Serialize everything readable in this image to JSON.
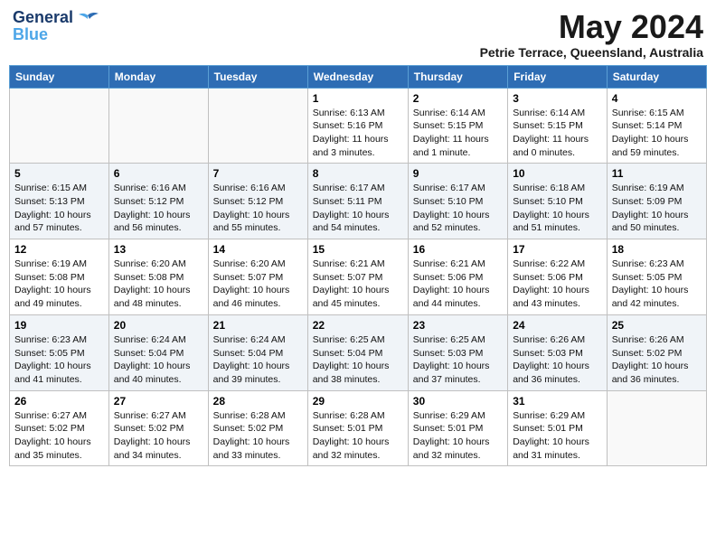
{
  "header": {
    "logo_line1": "General",
    "logo_line2": "Blue",
    "month_title": "May 2024",
    "location": "Petrie Terrace, Queensland, Australia"
  },
  "weekdays": [
    "Sunday",
    "Monday",
    "Tuesday",
    "Wednesday",
    "Thursday",
    "Friday",
    "Saturday"
  ],
  "weeks": [
    [
      {
        "day": "",
        "info": ""
      },
      {
        "day": "",
        "info": ""
      },
      {
        "day": "",
        "info": ""
      },
      {
        "day": "1",
        "info": "Sunrise: 6:13 AM\nSunset: 5:16 PM\nDaylight: 11 hours\nand 3 minutes."
      },
      {
        "day": "2",
        "info": "Sunrise: 6:14 AM\nSunset: 5:15 PM\nDaylight: 11 hours\nand 1 minute."
      },
      {
        "day": "3",
        "info": "Sunrise: 6:14 AM\nSunset: 5:15 PM\nDaylight: 11 hours\nand 0 minutes."
      },
      {
        "day": "4",
        "info": "Sunrise: 6:15 AM\nSunset: 5:14 PM\nDaylight: 10 hours\nand 59 minutes."
      }
    ],
    [
      {
        "day": "5",
        "info": "Sunrise: 6:15 AM\nSunset: 5:13 PM\nDaylight: 10 hours\nand 57 minutes."
      },
      {
        "day": "6",
        "info": "Sunrise: 6:16 AM\nSunset: 5:12 PM\nDaylight: 10 hours\nand 56 minutes."
      },
      {
        "day": "7",
        "info": "Sunrise: 6:16 AM\nSunset: 5:12 PM\nDaylight: 10 hours\nand 55 minutes."
      },
      {
        "day": "8",
        "info": "Sunrise: 6:17 AM\nSunset: 5:11 PM\nDaylight: 10 hours\nand 54 minutes."
      },
      {
        "day": "9",
        "info": "Sunrise: 6:17 AM\nSunset: 5:10 PM\nDaylight: 10 hours\nand 52 minutes."
      },
      {
        "day": "10",
        "info": "Sunrise: 6:18 AM\nSunset: 5:10 PM\nDaylight: 10 hours\nand 51 minutes."
      },
      {
        "day": "11",
        "info": "Sunrise: 6:19 AM\nSunset: 5:09 PM\nDaylight: 10 hours\nand 50 minutes."
      }
    ],
    [
      {
        "day": "12",
        "info": "Sunrise: 6:19 AM\nSunset: 5:08 PM\nDaylight: 10 hours\nand 49 minutes."
      },
      {
        "day": "13",
        "info": "Sunrise: 6:20 AM\nSunset: 5:08 PM\nDaylight: 10 hours\nand 48 minutes."
      },
      {
        "day": "14",
        "info": "Sunrise: 6:20 AM\nSunset: 5:07 PM\nDaylight: 10 hours\nand 46 minutes."
      },
      {
        "day": "15",
        "info": "Sunrise: 6:21 AM\nSunset: 5:07 PM\nDaylight: 10 hours\nand 45 minutes."
      },
      {
        "day": "16",
        "info": "Sunrise: 6:21 AM\nSunset: 5:06 PM\nDaylight: 10 hours\nand 44 minutes."
      },
      {
        "day": "17",
        "info": "Sunrise: 6:22 AM\nSunset: 5:06 PM\nDaylight: 10 hours\nand 43 minutes."
      },
      {
        "day": "18",
        "info": "Sunrise: 6:23 AM\nSunset: 5:05 PM\nDaylight: 10 hours\nand 42 minutes."
      }
    ],
    [
      {
        "day": "19",
        "info": "Sunrise: 6:23 AM\nSunset: 5:05 PM\nDaylight: 10 hours\nand 41 minutes."
      },
      {
        "day": "20",
        "info": "Sunrise: 6:24 AM\nSunset: 5:04 PM\nDaylight: 10 hours\nand 40 minutes."
      },
      {
        "day": "21",
        "info": "Sunrise: 6:24 AM\nSunset: 5:04 PM\nDaylight: 10 hours\nand 39 minutes."
      },
      {
        "day": "22",
        "info": "Sunrise: 6:25 AM\nSunset: 5:04 PM\nDaylight: 10 hours\nand 38 minutes."
      },
      {
        "day": "23",
        "info": "Sunrise: 6:25 AM\nSunset: 5:03 PM\nDaylight: 10 hours\nand 37 minutes."
      },
      {
        "day": "24",
        "info": "Sunrise: 6:26 AM\nSunset: 5:03 PM\nDaylight: 10 hours\nand 36 minutes."
      },
      {
        "day": "25",
        "info": "Sunrise: 6:26 AM\nSunset: 5:02 PM\nDaylight: 10 hours\nand 36 minutes."
      }
    ],
    [
      {
        "day": "26",
        "info": "Sunrise: 6:27 AM\nSunset: 5:02 PM\nDaylight: 10 hours\nand 35 minutes."
      },
      {
        "day": "27",
        "info": "Sunrise: 6:27 AM\nSunset: 5:02 PM\nDaylight: 10 hours\nand 34 minutes."
      },
      {
        "day": "28",
        "info": "Sunrise: 6:28 AM\nSunset: 5:02 PM\nDaylight: 10 hours\nand 33 minutes."
      },
      {
        "day": "29",
        "info": "Sunrise: 6:28 AM\nSunset: 5:01 PM\nDaylight: 10 hours\nand 32 minutes."
      },
      {
        "day": "30",
        "info": "Sunrise: 6:29 AM\nSunset: 5:01 PM\nDaylight: 10 hours\nand 32 minutes."
      },
      {
        "day": "31",
        "info": "Sunrise: 6:29 AM\nSunset: 5:01 PM\nDaylight: 10 hours\nand 31 minutes."
      },
      {
        "day": "",
        "info": ""
      }
    ]
  ]
}
